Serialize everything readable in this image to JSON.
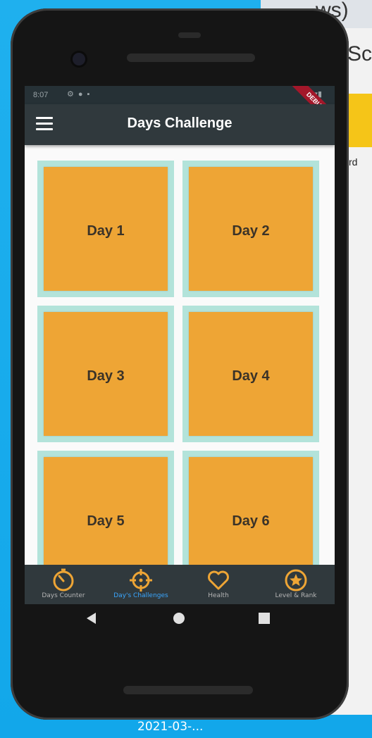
{
  "desktop": {
    "window_title": "ws)",
    "partial_text": "Sce",
    "app_label": "rd",
    "date_text": "2021-03-..."
  },
  "status_bar": {
    "time": "8:07",
    "debug_banner": "DEBUG"
  },
  "app_bar": {
    "title": "Days Challenge",
    "menu_icon": "hamburger-menu-icon"
  },
  "days": [
    {
      "label": "Day 1"
    },
    {
      "label": "Day 2"
    },
    {
      "label": "Day 3"
    },
    {
      "label": "Day 4"
    },
    {
      "label": "Day 5"
    },
    {
      "label": "Day 6"
    }
  ],
  "bottom_nav": {
    "items": [
      {
        "label": "Days Counter",
        "icon": "timer-icon"
      },
      {
        "label": "Day's Challenges",
        "icon": "crosshair-icon",
        "active": true
      },
      {
        "label": "Health",
        "icon": "heart-icon"
      },
      {
        "label": "Level & Rank",
        "icon": "star-badge-icon"
      }
    ]
  },
  "colors": {
    "tile": "#eea535",
    "tile_border": "#b3e3da",
    "app_bar": "#30393d",
    "nav_icon": "#eea535",
    "active_label": "#3aa7ff"
  }
}
